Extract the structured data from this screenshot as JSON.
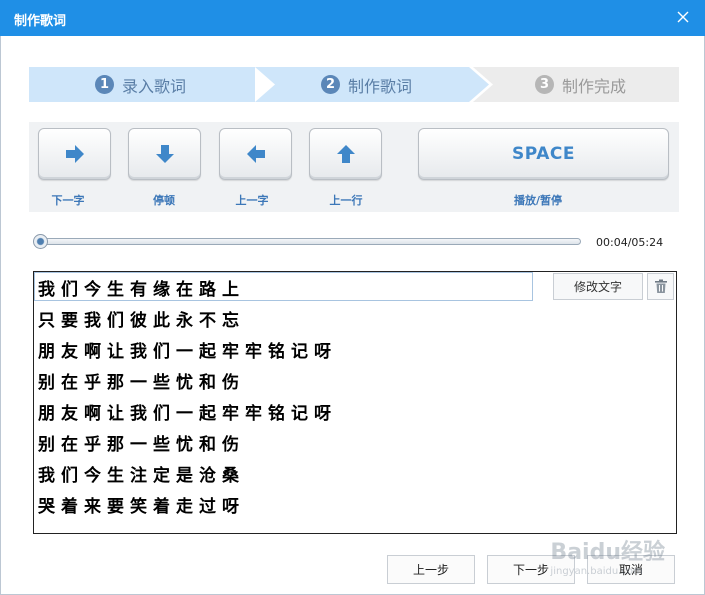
{
  "window": {
    "title": "制作歌词",
    "close_icon": "close-icon"
  },
  "steps": [
    {
      "num": "1",
      "label": "录入歌词",
      "state": "done"
    },
    {
      "num": "2",
      "label": "制作歌词",
      "state": "active"
    },
    {
      "num": "3",
      "label": "制作完成",
      "state": "pending"
    }
  ],
  "keys": [
    {
      "icon": "arrow-right-icon",
      "label": "下一字"
    },
    {
      "icon": "arrow-down-icon",
      "label": "停顿"
    },
    {
      "icon": "arrow-left-icon",
      "label": "上一字"
    },
    {
      "icon": "arrow-up-icon",
      "label": "上一行"
    },
    {
      "text": "SPACE",
      "label": "播放/暂停"
    }
  ],
  "player": {
    "time": "00:04/05:24",
    "progress": 0.0
  },
  "lyrics": {
    "lines": [
      "我们今生有缘在路上",
      "只要我们彼此永不忘",
      "朋友啊让我们一起牢牢铭记呀",
      "别在乎那一些忧和伤",
      "朋友啊让我们一起牢牢铭记呀",
      "别在乎那一些忧和伤",
      "我们今生注定是沧桑",
      "哭着来要笑着走过呀"
    ],
    "edit_text_label": "修改文字",
    "delete_icon": "trash-icon"
  },
  "footer": {
    "prev": "上一步",
    "next": "下一步",
    "cancel": "取消"
  },
  "colors": {
    "titlebar": "#1f8fe6",
    "step_active": "#cfe6fa",
    "step_inactive": "#ececec",
    "accent": "#3c77b8"
  },
  "watermark": {
    "text": "Baidu经验",
    "sub": "jingyan.baidu.com"
  }
}
